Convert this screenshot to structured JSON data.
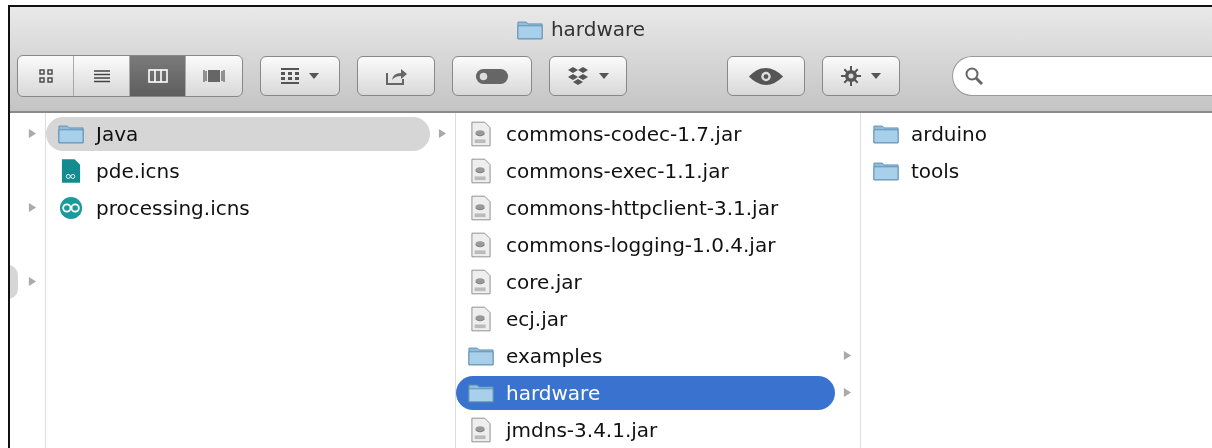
{
  "window": {
    "title": "hardware"
  },
  "toolbar": {
    "view_modes": [
      {
        "kind": "icons",
        "selected": false
      },
      {
        "kind": "list",
        "selected": false
      },
      {
        "kind": "columns",
        "selected": true
      },
      {
        "kind": "coverflow",
        "selected": false
      }
    ]
  },
  "columns": [
    {
      "items": [
        {
          "expandable": true,
          "selected": false
        },
        {
          "expandable": false,
          "selected": false
        },
        {
          "expandable": true,
          "selected": false
        },
        {
          "expandable": false,
          "selected": false
        },
        {
          "expandable": true,
          "selected": true
        }
      ]
    },
    {
      "items": [
        {
          "name": "Java",
          "kind": "folder",
          "expandable": true,
          "selected": true
        },
        {
          "name": "pde.icns",
          "kind": "pde",
          "expandable": false,
          "selected": false
        },
        {
          "name": "processing.icns",
          "kind": "processing",
          "expandable": false,
          "selected": false
        }
      ]
    },
    {
      "items": [
        {
          "name": "commons-codec-1.7.jar",
          "kind": "jar",
          "expandable": false,
          "selected": false
        },
        {
          "name": "commons-exec-1.1.jar",
          "kind": "jar",
          "expandable": false,
          "selected": false
        },
        {
          "name": "commons-httpclient-3.1.jar",
          "kind": "jar",
          "expandable": false,
          "selected": false
        },
        {
          "name": "commons-logging-1.0.4.jar",
          "kind": "jar",
          "expandable": false,
          "selected": false
        },
        {
          "name": "core.jar",
          "kind": "jar",
          "expandable": false,
          "selected": false
        },
        {
          "name": "ecj.jar",
          "kind": "jar",
          "expandable": false,
          "selected": false
        },
        {
          "name": "examples",
          "kind": "folder",
          "expandable": true,
          "selected": false
        },
        {
          "name": "hardware",
          "kind": "folder",
          "expandable": true,
          "selected": true
        },
        {
          "name": "jmdns-3.4.1.jar",
          "kind": "jar",
          "expandable": false,
          "selected": false
        }
      ]
    },
    {
      "items": [
        {
          "name": "arduino",
          "kind": "folder",
          "expandable": false,
          "selected": false
        },
        {
          "name": "tools",
          "kind": "folder",
          "expandable": false,
          "selected": false
        }
      ]
    }
  ]
}
